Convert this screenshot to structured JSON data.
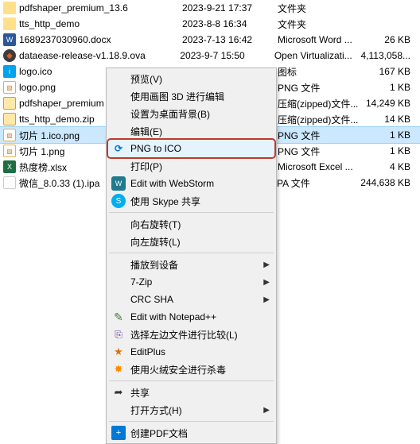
{
  "files": [
    {
      "icon": "folder",
      "name": "pdfshaper_premium_13.6",
      "date": "2023-9-21 17:37",
      "type": "文件夹",
      "size": ""
    },
    {
      "icon": "folder",
      "name": "tts_http_demo",
      "date": "2023-8-8 16:34",
      "type": "文件夹",
      "size": ""
    },
    {
      "icon": "docx",
      "name": "1689237030960.docx",
      "date": "2023-7-13 16:42",
      "type": "Microsoft Word ...",
      "size": "26 KB"
    },
    {
      "icon": "ova",
      "name": "dataease-release-v1.18.9.ova",
      "date": "2023-9-7 15:50",
      "type": "Open Virtualizati...",
      "size": "4,113,058..."
    },
    {
      "icon": "ico",
      "name": "logo.ico",
      "date": "",
      "type": "图标",
      "size": "167 KB"
    },
    {
      "icon": "png",
      "name": "logo.png",
      "date": "",
      "type": "PNG 文件",
      "size": "1 KB"
    },
    {
      "icon": "zip",
      "name": "pdfshaper_premium",
      "date": "",
      "type": "压缩(zipped)文件...",
      "size": "14,249 KB"
    },
    {
      "icon": "zip",
      "name": "tts_http_demo.zip",
      "date": "",
      "type": "压缩(zipped)文件...",
      "size": "14 KB"
    },
    {
      "icon": "png",
      "name": "切片 1.ico.png",
      "date": "",
      "type": "PNG 文件",
      "size": "1 KB",
      "selected": true
    },
    {
      "icon": "png",
      "name": "切片 1.png",
      "date": "",
      "type": "PNG 文件",
      "size": "1 KB"
    },
    {
      "icon": "xlsx",
      "name": "热度榜.xlsx",
      "date": "",
      "type": "Microsoft Excel ...",
      "size": "4 KB"
    },
    {
      "icon": "ipa",
      "name": "微信_8.0.33 (1).ipa",
      "date": "",
      "type": "IPA 文件",
      "size": "244,638 KB"
    }
  ],
  "menu": {
    "preview": "预览(V)",
    "paint3d": "使用画图 3D 进行编辑",
    "setbg": "设置为桌面背景(B)",
    "edit": "编辑(E)",
    "pngico": "PNG to ICO",
    "print": "打印(P)",
    "webstorm": "Edit with WebStorm",
    "skype": "使用 Skype 共享",
    "rotr": "向右旋转(T)",
    "rotl": "向左旋转(L)",
    "cast": "播放到设备",
    "7zip": "7-Zip",
    "crc": "CRC SHA",
    "notepad": "Edit with Notepad++",
    "compare": "选择左边文件进行比较(L)",
    "editplus": "EditPlus",
    "huorong": "使用火绒安全进行杀毒",
    "share": "共享",
    "openwith": "打开方式(H)",
    "pdf": "创建PDF文档"
  }
}
